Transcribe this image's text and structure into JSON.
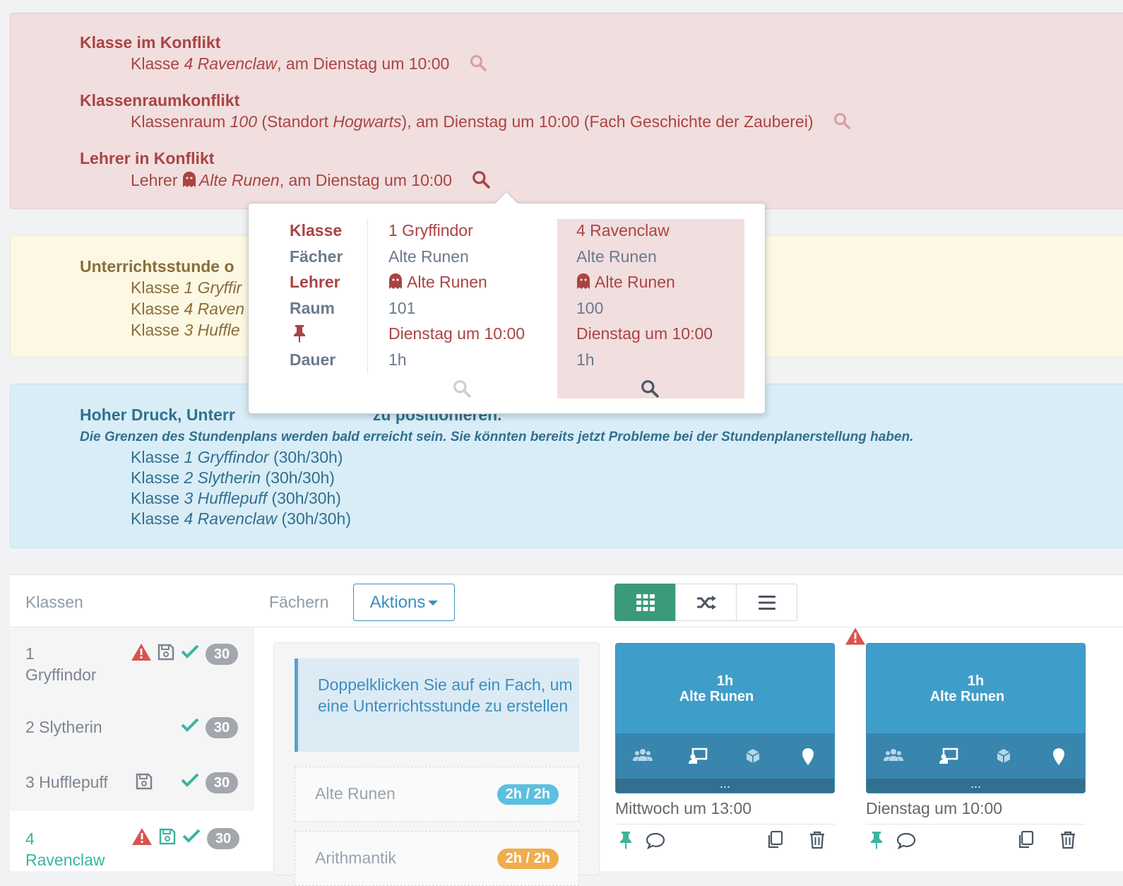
{
  "alerts": {
    "danger": {
      "items": [
        {
          "title": "Klasse im Konflikt",
          "prefix": "Klasse ",
          "italic": "4 Ravenclaw",
          "suffix": ", am Dienstag um 10:00"
        },
        {
          "title": "Klassenraumkonflikt",
          "prefix": "Klassenraum ",
          "italic": "100",
          "mid": " (Standort ",
          "italic2": "Hogwarts",
          "suffix": "), am Dienstag um 10:00 (Fach Geschichte der Zauberei)"
        },
        {
          "title": "Lehrer in Konflikt",
          "prefix": "Lehrer ",
          "italic": "Alte Runen",
          "suffix": ", am Dienstag um 10:00"
        }
      ]
    },
    "warning": {
      "title": "Unterrichtsstunde o",
      "lines": [
        {
          "prefix": "Klasse ",
          "italic": "1 Gryffir"
        },
        {
          "prefix": "Klasse ",
          "italic": "4 Raven"
        },
        {
          "prefix": "Klasse ",
          "italic": "3 Huffle"
        }
      ]
    },
    "info": {
      "title": "Hoher Druck, Unterr",
      "title_tail": "zu positionieren.",
      "subtitle": "Die Grenzen des Stundenplans werden bald erreicht sein. Sie könnten bereits jetzt Probleme bei der Stundenplanerstellung haben.",
      "lines": [
        {
          "prefix": "Klasse ",
          "italic": "1 Gryffindor",
          "suffix": " (30h/30h)"
        },
        {
          "prefix": "Klasse ",
          "italic": "2 Slytherin",
          "suffix": " (30h/30h)"
        },
        {
          "prefix": "Klasse ",
          "italic": "3 Hufflepuff",
          "suffix": " (30h/30h)"
        },
        {
          "prefix": "Klasse ",
          "italic": "4 Ravenclaw",
          "suffix": " (30h/30h)"
        }
      ]
    }
  },
  "popover": {
    "labels": [
      "Klasse",
      "Fächer",
      "Lehrer",
      "Raum",
      "",
      "Dauer"
    ],
    "col1": {
      "klasse": "1 Gryffindor",
      "faecher": "Alte Runen",
      "lehrer": "Alte Runen",
      "raum": "101",
      "zeit": "Dienstag um 10:00",
      "dauer": "1h"
    },
    "col2": {
      "klasse": "4 Ravenclaw",
      "faecher": "Alte Runen",
      "lehrer": "Alte Runen",
      "raum": "100",
      "zeit": "Dienstag um 10:00",
      "dauer": "1h"
    }
  },
  "toolbar": {
    "klassen_tab": "Klassen",
    "faechern_tab": "Fächern",
    "aktions_label": "Aktions"
  },
  "classes": [
    {
      "name": "1\nGryffindor",
      "count": "30"
    },
    {
      "name": "2 Slytherin",
      "count": "30"
    },
    {
      "name": "3 Hufflepuff",
      "count": "30"
    },
    {
      "name": "4\nRavenclaw",
      "count": "30"
    }
  ],
  "hint": "Doppelklicken Sie auf ein Fach, um eine Unterrichtsstunde zu erstellen",
  "subjects": [
    {
      "name": "Alte Runen",
      "badge": "2h / 2h",
      "color": "#5bc0de"
    },
    {
      "name": "Arithmantik",
      "badge": "2h / 2h",
      "color": "#f0ad4e"
    }
  ],
  "lessons": [
    {
      "duration": "1h",
      "subject": "Alte Runen",
      "more": "...",
      "time": "Mittwoch um 13:00"
    },
    {
      "duration": "1h",
      "subject": "Alte Runen",
      "more": "...",
      "time": "Dienstag um 10:00"
    }
  ],
  "colors": {
    "danger": "#a94442",
    "warning": "#8a6d3b",
    "info": "#31708f",
    "accent": "#3a9a7a",
    "link": "#3b8fbf"
  }
}
